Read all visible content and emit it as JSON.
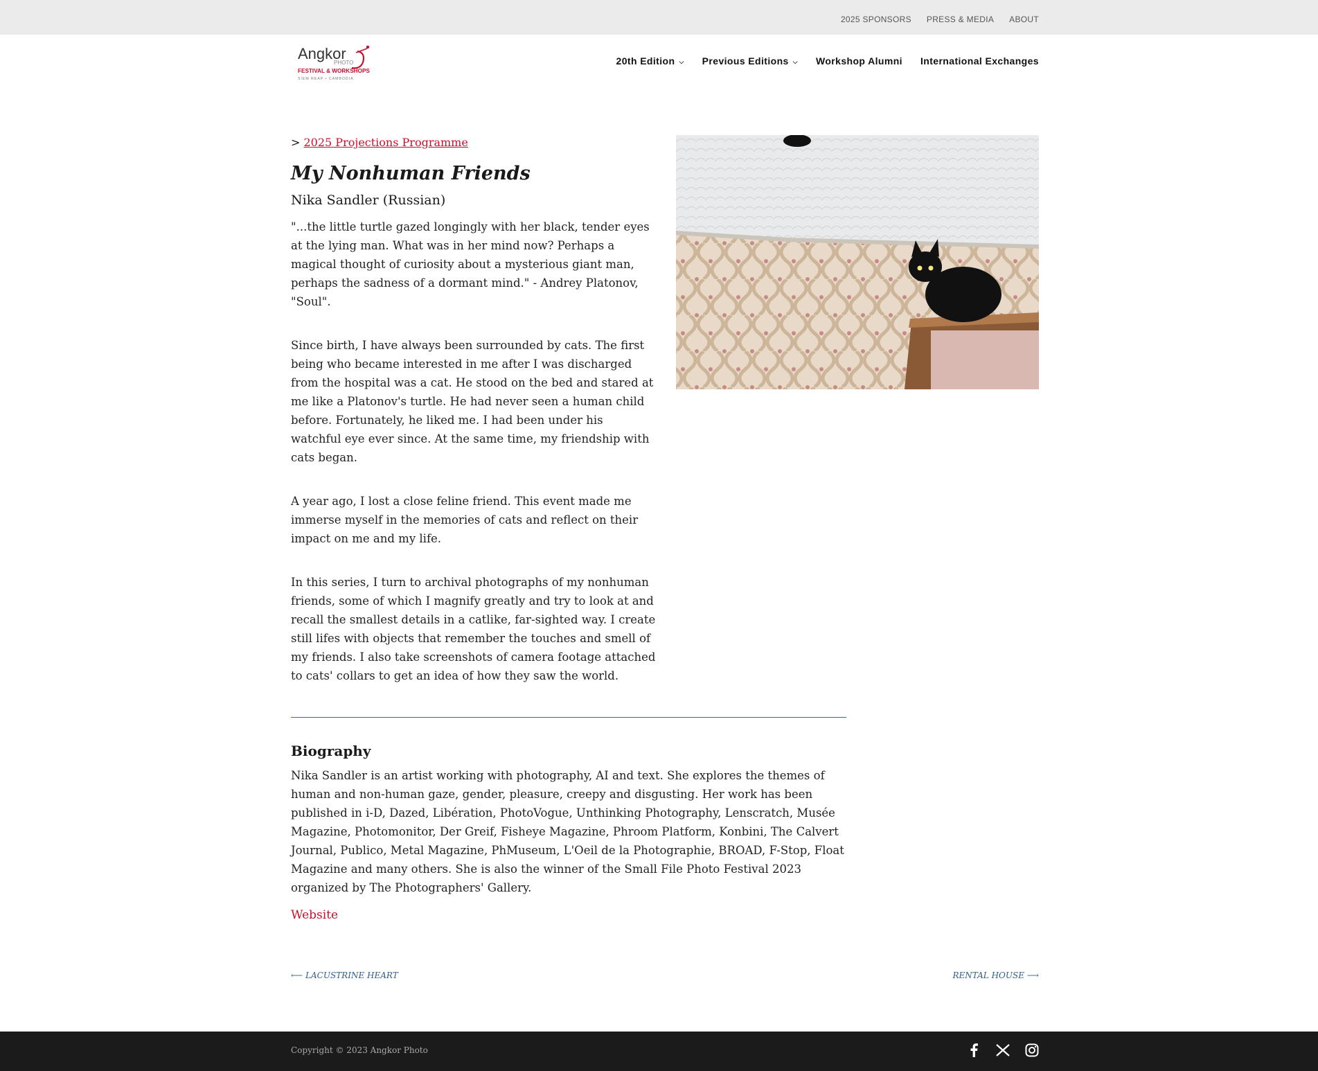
{
  "topbar": {
    "links": [
      "2025 SPONSORS",
      "PRESS & MEDIA",
      "ABOUT"
    ]
  },
  "logo": {
    "line1": "Angkor",
    "line2": "PHOTO",
    "line3": "FESTIVAL & WORKSHOPS",
    "line4": "SIEM REAP • CAMBODIA"
  },
  "nav": {
    "items": [
      {
        "label": "20th Edition",
        "has_dropdown": true
      },
      {
        "label": "Previous Editions",
        "has_dropdown": true
      },
      {
        "label": "Workshop Alumni",
        "has_dropdown": false
      },
      {
        "label": "International Exchanges",
        "has_dropdown": false
      }
    ]
  },
  "breadcrumb": {
    "prefix": ">",
    "link": "2025 Projections Programme"
  },
  "article": {
    "title": "My Nonhuman Friends",
    "artist": "Nika Sandler (Russian)",
    "paragraphs": [
      "\"...the little turtle gazed longingly with her black, tender eyes at the lying man. What was in her mind now? Perhaps a magical thought of curiosity about a mysterious giant man, perhaps the sadness of a dormant mind.\" - Andrey Platonov, \"Soul\".",
      "Since birth, I have always been surrounded by cats. The first being who became interested in me after I was discharged from the hospital was a cat. He stood on the bed and stared at me like a Platonov's turtle. He had never seen a human child before. Fortunately, he liked me. I had been under his watchful eye ever since. At the same time, my friendship with cats began.",
      "A year ago, I lost a close feline friend. This event made me immerse myself in the memories of cats and reflect on their impact on me and my life.",
      "In this series, I turn to archival photographs of my nonhuman friends, some of which I magnify greatly and try to look at and recall the smallest details in a catlike, far-sighted way. I create still lifes with objects that remember the touches and smell of my friends. I also take screenshots of camera footage attached to cats' collars to get an idea of how they saw the world."
    ]
  },
  "biography": {
    "heading": "Biography",
    "text": "Nika Sandler is an artist working with photography, AI and text. She explores the themes of human and non-human gaze, gender, pleasure, creepy and disgusting. Her work has been published in i-D, Dazed, Libération, PhotoVogue, Unthinking Photography, Lenscratch, Musée Magazine, Photomonitor, Der Greif, Fisheye Magazine, Phroom Platform, Konbini, The Calvert Journal, Publico, Metal Magazine, PhMuseum, L'Oeil de la Photographie, BROAD, F-Stop, Float Magazine and many others. She is also the winner of the Small File Photo Festival 2023 organized by The Photographers' Gallery.",
    "website_label": "Website"
  },
  "post_nav": {
    "prev": "⟵ LACUSTRINE HEART",
    "next": "RENTAL HOUSE ⟶"
  },
  "footer": {
    "copyright": "Copyright © 2023 Angkor Photo",
    "social_icons": [
      "facebook-icon",
      "x-icon",
      "instagram-icon"
    ]
  },
  "colors": {
    "accent_red": "#c8102e",
    "link_blue": "#2f5f8a",
    "topbar_bg": "#ebebeb",
    "footer_bg": "#1b1b1b"
  }
}
